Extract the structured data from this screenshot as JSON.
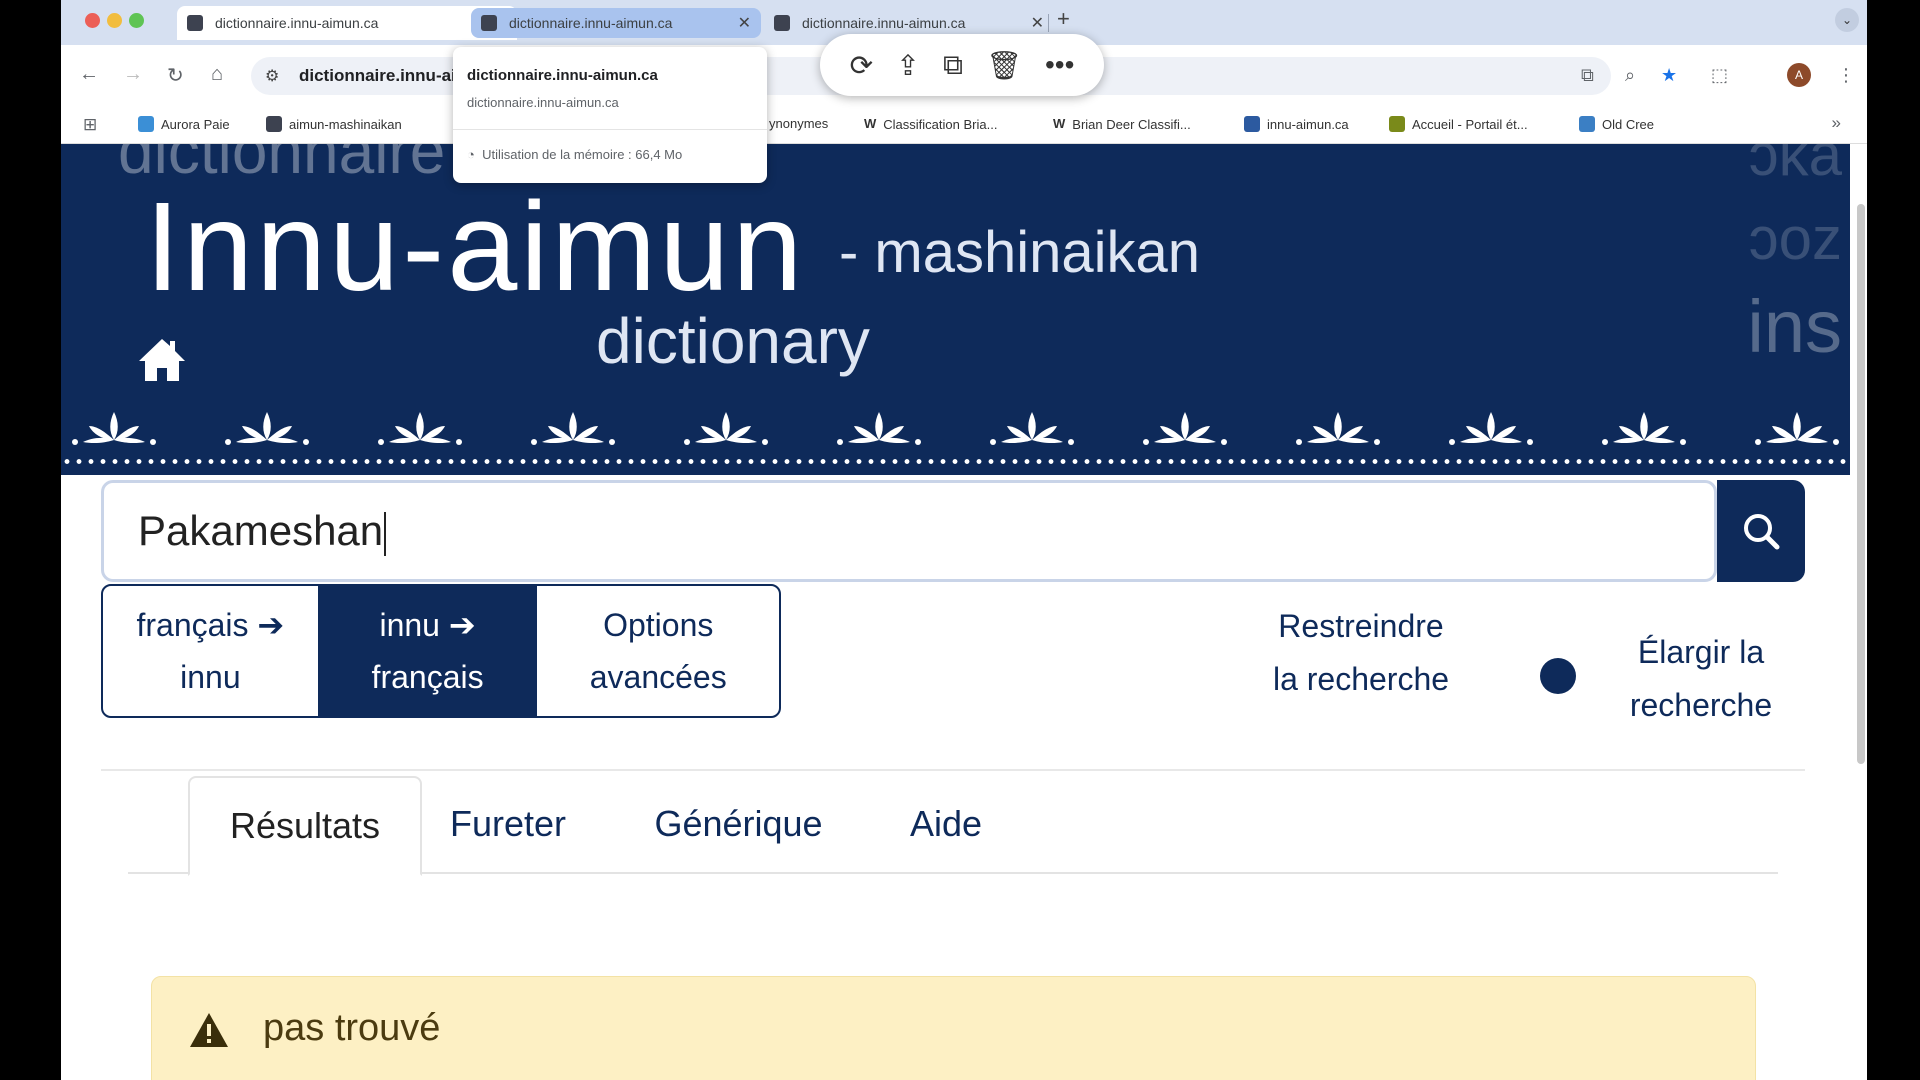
{
  "browser": {
    "tabs": [
      {
        "title": "dictionnaire.innu-aimun.ca",
        "state": "active"
      },
      {
        "title": "dictionnaire.innu-aimun.ca",
        "state": "hover"
      },
      {
        "title": "dictionnaire.innu-aimun.ca",
        "state": "normal"
      }
    ],
    "address": "dictionnaire.innu-ai",
    "hover_card": {
      "title": "dictionnaire.innu-aimun.ca",
      "url": "dictionnaire.innu-aimun.ca",
      "memory": "Utilisation de la mémoire : 66,4 Mo"
    },
    "avatar_letter": "A",
    "bookmarks": [
      {
        "label": "Aurora Paie",
        "color": "#3b8fd6"
      },
      {
        "label": "aimun-mashinaikan",
        "color": "#3d4250"
      },
      {
        "label": "ynonymes",
        "color": "#ffffff"
      },
      {
        "label": "Classification Bria...",
        "color": "#ffffff"
      },
      {
        "label": "Brian Deer Classifi...",
        "color": "#ffffff"
      },
      {
        "label": "innu-aimun.ca",
        "color": "#2c5aa0"
      },
      {
        "label": "Accueil - Portail ét...",
        "color": "#7a8a1a"
      },
      {
        "label": "Old Cree",
        "color": "#3b7fc4"
      }
    ]
  },
  "header": {
    "ghost_text": "dictionnaire",
    "ghost_right": [
      "ɔka",
      "ɔoz",
      "ins"
    ],
    "title": "Innu-aimun",
    "subtitle": "- mashinaikan",
    "dictionary_word": "dictionary"
  },
  "search": {
    "value": "Pakameshan"
  },
  "modes": [
    {
      "label": "français ➔ innu",
      "selected": false
    },
    {
      "label": "innu ➔ français",
      "selected": true
    },
    {
      "label": "Options avancées",
      "selected": false
    }
  ],
  "scope": {
    "restrict_label": "Restreindre la recherche",
    "broaden_label": "Élargir la recherche"
  },
  "tabs": [
    {
      "label": "Résultats",
      "active": true
    },
    {
      "label": "Fureter",
      "active": false
    },
    {
      "label": "Générique",
      "active": false
    },
    {
      "label": "Aide",
      "active": false
    }
  ],
  "alert": {
    "message": "pas trouvé",
    "color": "#fdf0c4"
  },
  "colors": {
    "brand_navy": "#0e2a5a"
  }
}
